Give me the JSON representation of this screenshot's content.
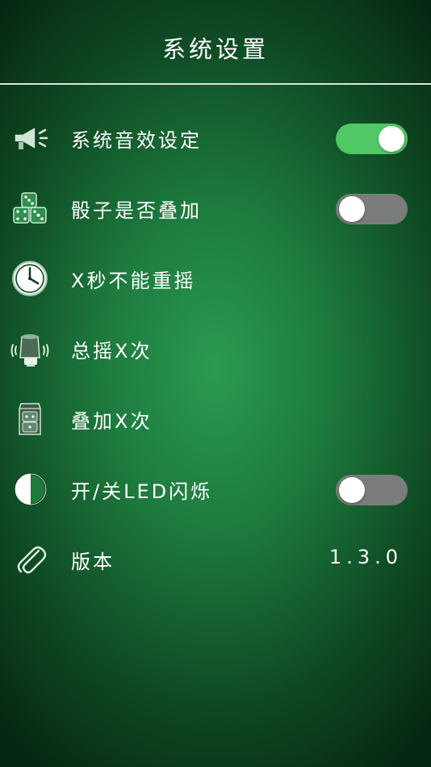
{
  "header": {
    "title": "系统设置"
  },
  "settings": [
    {
      "label": "系统音效设定",
      "icon": "megaphone-icon",
      "toggle": true
    },
    {
      "label": "骰子是否叠加",
      "icon": "dice-icon",
      "toggle": false
    },
    {
      "label": "X秒不能重摇",
      "icon": "clock-icon"
    },
    {
      "label": "总摇X次",
      "icon": "shaking-cup-icon"
    },
    {
      "label": "叠加X次",
      "icon": "stacked-dice-icon"
    },
    {
      "label": "开/关LED闪烁",
      "icon": "half-circle-icon",
      "toggle": false
    },
    {
      "label": "版本",
      "icon": "paperclip-icon",
      "value": "1.3.0"
    }
  ],
  "colors": {
    "toggle_on": "#52c766",
    "toggle_off": "#7a7d7c",
    "background_center": "#2a9a52",
    "background_edge": "#062812"
  }
}
